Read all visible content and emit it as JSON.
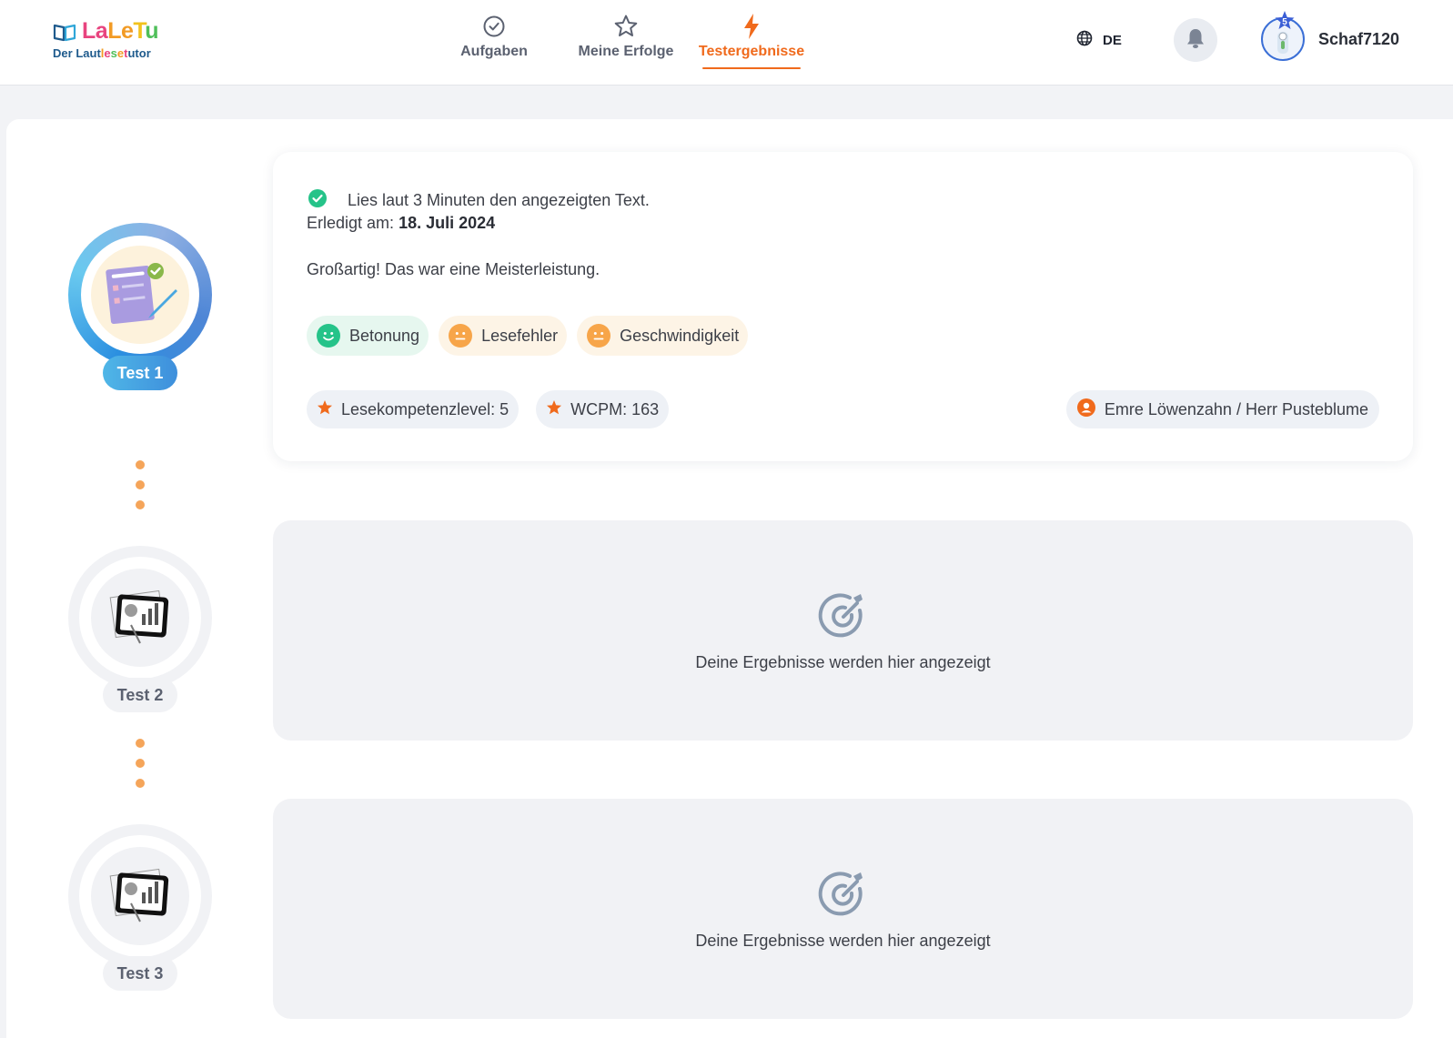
{
  "logo": {
    "title_letters": [
      "La",
      "Le",
      "T",
      "u"
    ],
    "title": "LaLeTu",
    "subtitle": "Der Lautlesetutor"
  },
  "nav": {
    "items": [
      {
        "label": "Aufgaben",
        "icon": "check-circle-icon",
        "active": false
      },
      {
        "label": "Meine Erfolge",
        "icon": "star-outline-icon",
        "active": false
      },
      {
        "label": "Testergebnisse",
        "icon": "lightning-icon",
        "active": true
      }
    ]
  },
  "header": {
    "language": "DE",
    "notification_icon": "bell-icon",
    "avatar_level": "5",
    "username": "Schaf7120"
  },
  "steps": [
    {
      "label": "Test 1",
      "state": "completed"
    },
    {
      "label": "Test 2",
      "state": "pending"
    },
    {
      "label": "Test 3",
      "state": "pending"
    }
  ],
  "result": {
    "task": "Lies laut 3 Minuten den angezeigten Text.",
    "done_prefix": "Erledigt am:",
    "done_date": "18. Juli 2024",
    "feedback": "Großartig! Das war eine Meisterleistung.",
    "ratings": [
      {
        "label": "Betonung",
        "mood": "happy"
      },
      {
        "label": "Lesefehler",
        "mood": "neutral"
      },
      {
        "label": "Geschwindigkeit",
        "mood": "neutral"
      }
    ],
    "stats": [
      {
        "label": "Lesekompetenzlevel: 5"
      },
      {
        "label": "WCPM: 163"
      }
    ],
    "teacher": "Emre Löwenzahn / Herr Pusteblume"
  },
  "placeholders": [
    {
      "text": "Deine Ergebnisse werden hier angezeigt"
    },
    {
      "text": "Deine Ergebnisse werden hier angezeigt"
    }
  ],
  "colors": {
    "accent": "#f06a1c",
    "active_ring": "#4fb6e7",
    "dots": "#f5a55a",
    "good": "#25c389",
    "neutral": "#f7a549"
  }
}
